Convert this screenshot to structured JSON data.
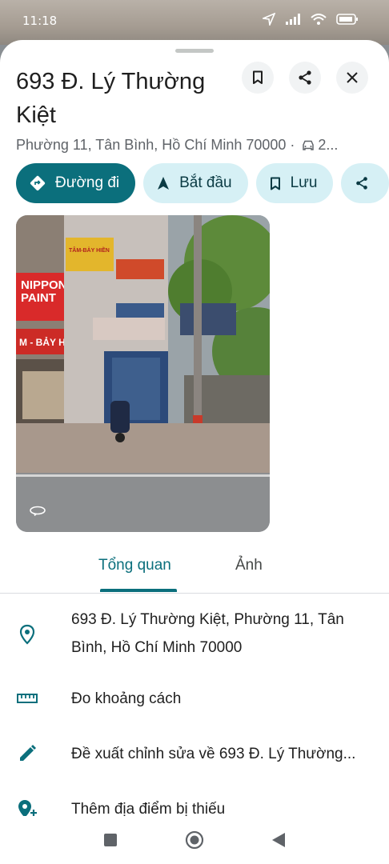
{
  "status_bar": {
    "time": "11:18"
  },
  "place": {
    "title": "693 Đ. Lý Thường Kiệt",
    "subtitle": "Phường 11, Tân Bình, Hồ Chí Minh 70000 · ",
    "drive_time": "2..."
  },
  "actions": [
    {
      "label": "Đường đi",
      "icon": "directions-icon"
    },
    {
      "label": "Bắt đầu",
      "icon": "navigation-arrow-icon"
    },
    {
      "label": "Lưu",
      "icon": "bookmark-icon"
    }
  ],
  "photo": {
    "signs": {
      "nippon_line1": "NIPPON",
      "nippon_line2": "PAINT",
      "store": "M - BẢY HIỀN",
      "top_store": "TÂM-BẢY HIỀN"
    }
  },
  "tabs": [
    {
      "label": "Tổng quan",
      "active": true
    },
    {
      "label": "Ảnh",
      "active": false
    }
  ],
  "details": [
    {
      "icon": "location-pin-icon",
      "text": "693 Đ. Lý Thường Kiệt, Phường 11, Tân Bình, Hồ Chí Minh 70000"
    },
    {
      "icon": "ruler-icon",
      "text": "Đo khoảng cách"
    },
    {
      "icon": "edit-pencil-icon",
      "text": "Đề xuất chỉnh sửa về 693 Đ. Lý Thường..."
    },
    {
      "icon": "add-location-icon",
      "text": "Thêm địa điểm bị thiếu"
    }
  ],
  "colors": {
    "primary": "#0b6f7c",
    "chip_bg": "#d6f0f5",
    "icon_teal": "#0b6f7c"
  }
}
